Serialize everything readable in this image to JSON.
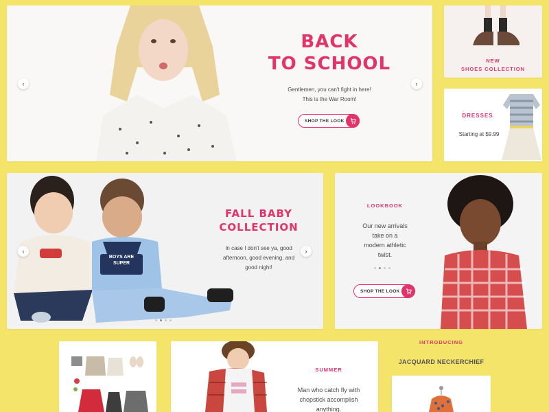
{
  "hero": {
    "title_line1": "BACK",
    "title_line2": "TO SCHOOL",
    "text_line1": "Gentlemen, you can't fight in here!",
    "text_line2": "This is the War Room!",
    "button_label": "SHOP THE LOOK"
  },
  "shoes": {
    "line1": "NEW",
    "line2": "SHOES COLLECTION"
  },
  "dresses": {
    "title": "DRESSES",
    "price": "Starting at $9.99"
  },
  "baby": {
    "title_line1": "FALL BABY",
    "title_line2": "COLLECTION",
    "text_line1": "In case I don't see ya, good",
    "text_line2": "afternoon, good evening, and",
    "text_line3": "good night!",
    "shirt_text": "BOYS ARE SUPER"
  },
  "lookbook": {
    "label": "LOOKBOOK",
    "text_line1": "Our new arrivals",
    "text_line2": "take on a",
    "text_line3": "modern athletic",
    "text_line4": "twist.",
    "button_label": "SHOP THE LOOK"
  },
  "summer": {
    "label": "SUMMER",
    "text_line1": "Man who catch fly with",
    "text_line2": "chopstick accomplish",
    "text_line3": "anything."
  },
  "introducing": {
    "label": "INTRODUCING",
    "product": "JACQUARD NECKERCHIEF"
  },
  "colors": {
    "accent": "#e2336b",
    "background": "#f5e46a"
  }
}
